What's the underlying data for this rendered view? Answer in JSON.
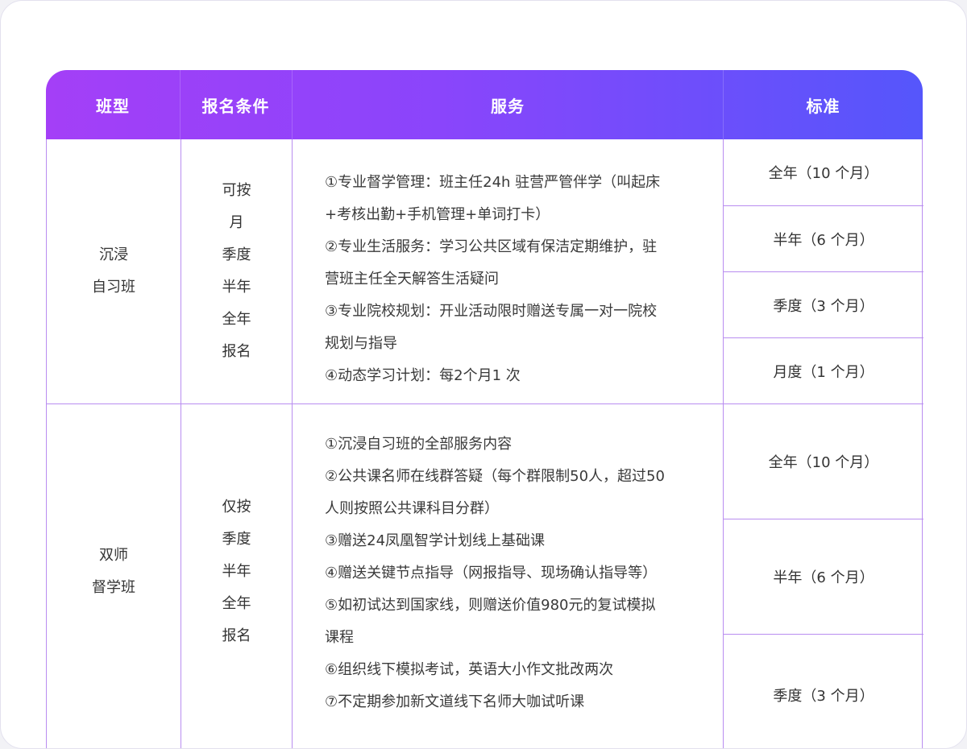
{
  "header": {
    "col_type": "班型",
    "col_condition": "报名条件",
    "col_service": "服务",
    "col_standard": "标准"
  },
  "colors": {
    "header_gradient_start": "#a43ff7",
    "header_gradient_end": "#5556fb",
    "grid_line": "#b98df0",
    "text": "#333333"
  },
  "rows": [
    {
      "type_lines": [
        "沉浸",
        "自习班"
      ],
      "condition_lines": [
        "可按",
        "月",
        "季度",
        "半年",
        "全年",
        "报名"
      ],
      "service_lines": [
        "①专业督学管理：班主任24h   驻营严管伴学（叫起床",
        "+考核出勤+手机管理+单词打卡）",
        "②专业生活服务：学习公共区域有保洁定期维护，驻",
        "营班主任全天解答生活疑问",
        "③专业院校规划：开业活动限时赠送专属一对一院校",
        "规划与指导",
        "④动态学习计划：每2个月1 次"
      ],
      "standards": [
        "全年（10 个月）",
        "半年（6 个月）",
        "季度（3 个月）",
        "月度（1 个月）"
      ]
    },
    {
      "type_lines": [
        "双师",
        "督学班"
      ],
      "condition_lines": [
        "仅按",
        "季度",
        "半年",
        "全年",
        "报名"
      ],
      "service_lines": [
        "①沉浸自习班的全部服务内容",
        "②公共课名师在线群答疑（每个群限制50人，超过50",
        "人则按照公共课科目分群）",
        "③赠送24凤凰智学计划线上基础课",
        "④赠送关键节点指导（网报指导、现场确认指导等）",
        "⑤如初试达到国家线，则赠送价值980元的复试模拟",
        "课程",
        "⑥组织线下模拟考试，英语大小作文批改两次",
        "⑦不定期参加新文道线下名师大咖试听课"
      ],
      "standards": [
        "全年（10 个月）",
        "半年（6 个月）",
        "季度（3 个月）"
      ]
    }
  ]
}
